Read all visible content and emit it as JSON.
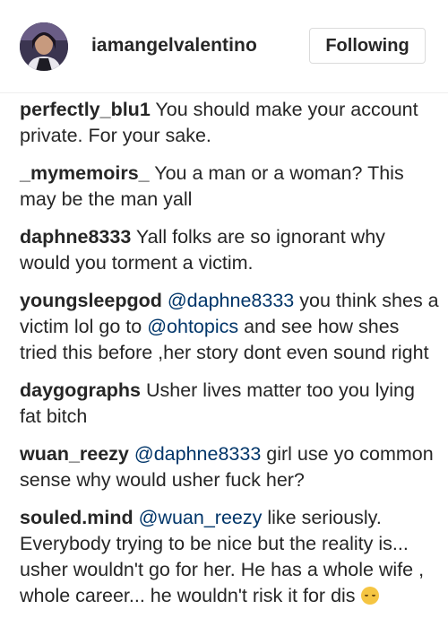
{
  "post_header": {
    "username": "iamangelvalentino",
    "follow_button_label": "Following",
    "avatar_icon": "profile-photo"
  },
  "comments": [
    {
      "author": "perfectly_blu1",
      "text_before": "",
      "mention": "",
      "text": "You should make your account private. For your sake."
    },
    {
      "author": "_mymemoirs_",
      "text_before": "",
      "mention": "",
      "text": "You a man or a woman? This may be the man yall"
    },
    {
      "author": "daphne8333",
      "text_before": "",
      "mention": "",
      "text": "Yall folks are so ignorant why would you torment a victim."
    },
    {
      "author": "youngsleepgod",
      "text_before": "",
      "mention": "@daphne8333",
      "text_mid": "you think shes a victim lol go to",
      "mention2": "@ohtopics",
      "text": "and see how shes tried this before ,her story dont even sound right"
    },
    {
      "author": "daygographs",
      "text_before": "",
      "mention": "",
      "text": "Usher lives matter too you lying fat bitch"
    },
    {
      "author": "wuan_reezy",
      "text_before": "",
      "mention": "@daphne8333",
      "text": "girl use yo common sense why would usher fuck her?"
    },
    {
      "author": "souled.mind",
      "text_before": "",
      "mention": "@wuan_reezy",
      "text": "like seriously. Everybody trying to be nice but the reality is... usher wouldn't go for her. He has a whole wife , whole career... he wouldn't risk it for dis",
      "emoji": "upside-down-face-emoji"
    }
  ],
  "colors": {
    "text": "#262626",
    "mention": "#003569",
    "border": "#dbdbdb"
  }
}
